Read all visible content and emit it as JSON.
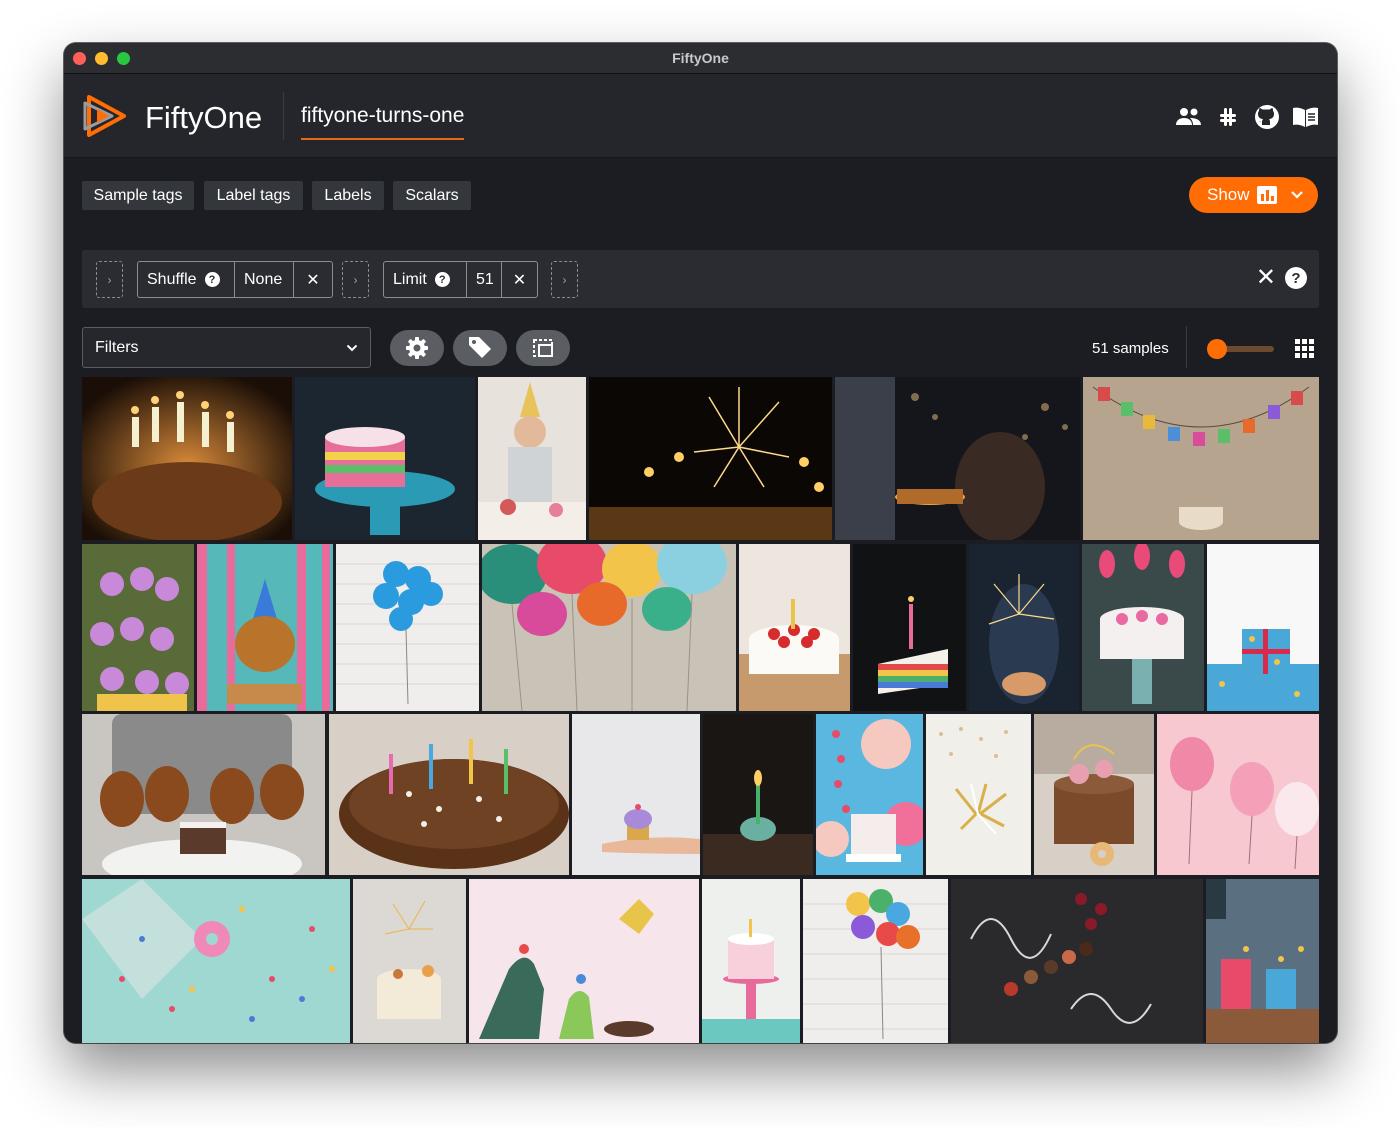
{
  "window": {
    "title": "FiftyOne"
  },
  "header": {
    "brand": "FiftyOne",
    "dataset_name": "fiftyone-turns-one",
    "icons": [
      "team-icon",
      "slack-icon",
      "github-icon",
      "docs-book-icon"
    ]
  },
  "tabs": [
    {
      "label": "Sample tags"
    },
    {
      "label": "Label tags"
    },
    {
      "label": "Labels"
    },
    {
      "label": "Scalars"
    }
  ],
  "show_button": {
    "label": "Show"
  },
  "view_bar": {
    "stages": [
      {
        "name": "Shuffle",
        "value": "None"
      },
      {
        "name": "Limit",
        "value": "51"
      }
    ],
    "help": "?",
    "clear": "✕"
  },
  "filters": {
    "label": "Filters"
  },
  "sample_count": "51 samples",
  "colors": {
    "accent": "#ff6d04",
    "background": "#1b1d22",
    "panel": "#2a2c31"
  },
  "gallery": {
    "rows": [
      [
        "candles-cake",
        "rainbow-cake-stand",
        "party-hat-man",
        "sparkler-candles",
        "couple-cake-bokeh",
        "birthday-banner"
      ],
      [
        "cupcake-tower",
        "dog-party-hat",
        "blue-balloons-brick",
        "colorful-balloons",
        "strawberry-cake",
        "rainbow-cake-slice",
        "sparkler-hands",
        "flower-cake-tulips",
        "gift-box"
      ],
      [
        "dachshunds-cake",
        "chocolate-cake-candles",
        "hand-cupcake",
        "cupcake-dark",
        "pastel-pinwheel-cake",
        "gold-confetti",
        "floral-cake",
        "pink-balloons"
      ],
      [
        "donut-confetti",
        "sparkler-cake",
        "dinosaur-toys",
        "pink-cake-stand",
        "balloons-brick",
        "chalkboard-happy-birthday",
        "party-gifts"
      ]
    ]
  }
}
